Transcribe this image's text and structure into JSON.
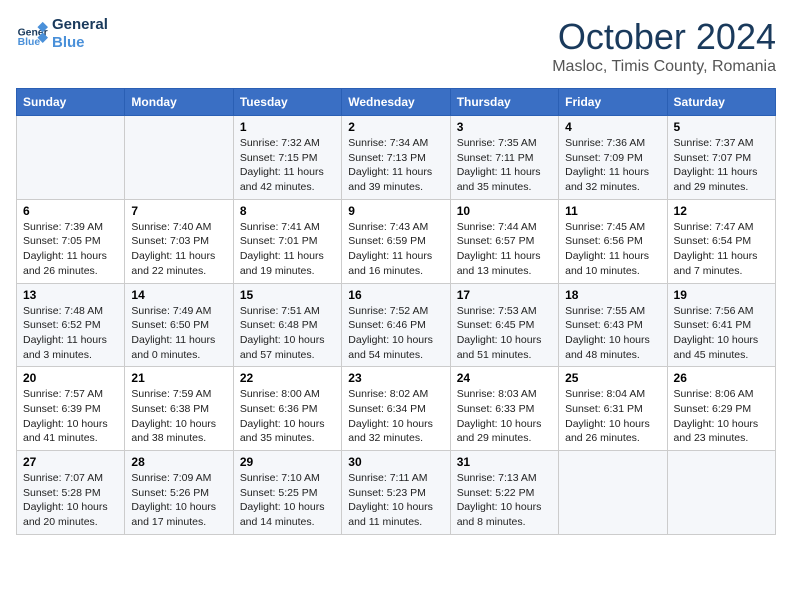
{
  "header": {
    "logo_line1": "General",
    "logo_line2": "Blue",
    "month": "October 2024",
    "location": "Masloc, Timis County, Romania"
  },
  "days_of_week": [
    "Sunday",
    "Monday",
    "Tuesday",
    "Wednesday",
    "Thursday",
    "Friday",
    "Saturday"
  ],
  "weeks": [
    [
      {
        "day": "",
        "info": ""
      },
      {
        "day": "",
        "info": ""
      },
      {
        "day": "1",
        "sunrise": "7:32 AM",
        "sunset": "7:15 PM",
        "daylight": "11 hours and 42 minutes."
      },
      {
        "day": "2",
        "sunrise": "7:34 AM",
        "sunset": "7:13 PM",
        "daylight": "11 hours and 39 minutes."
      },
      {
        "day": "3",
        "sunrise": "7:35 AM",
        "sunset": "7:11 PM",
        "daylight": "11 hours and 35 minutes."
      },
      {
        "day": "4",
        "sunrise": "7:36 AM",
        "sunset": "7:09 PM",
        "daylight": "11 hours and 32 minutes."
      },
      {
        "day": "5",
        "sunrise": "7:37 AM",
        "sunset": "7:07 PM",
        "daylight": "11 hours and 29 minutes."
      }
    ],
    [
      {
        "day": "6",
        "sunrise": "7:39 AM",
        "sunset": "7:05 PM",
        "daylight": "11 hours and 26 minutes."
      },
      {
        "day": "7",
        "sunrise": "7:40 AM",
        "sunset": "7:03 PM",
        "daylight": "11 hours and 22 minutes."
      },
      {
        "day": "8",
        "sunrise": "7:41 AM",
        "sunset": "7:01 PM",
        "daylight": "11 hours and 19 minutes."
      },
      {
        "day": "9",
        "sunrise": "7:43 AM",
        "sunset": "6:59 PM",
        "daylight": "11 hours and 16 minutes."
      },
      {
        "day": "10",
        "sunrise": "7:44 AM",
        "sunset": "6:57 PM",
        "daylight": "11 hours and 13 minutes."
      },
      {
        "day": "11",
        "sunrise": "7:45 AM",
        "sunset": "6:56 PM",
        "daylight": "11 hours and 10 minutes."
      },
      {
        "day": "12",
        "sunrise": "7:47 AM",
        "sunset": "6:54 PM",
        "daylight": "11 hours and 7 minutes."
      }
    ],
    [
      {
        "day": "13",
        "sunrise": "7:48 AM",
        "sunset": "6:52 PM",
        "daylight": "11 hours and 3 minutes."
      },
      {
        "day": "14",
        "sunrise": "7:49 AM",
        "sunset": "6:50 PM",
        "daylight": "11 hours and 0 minutes."
      },
      {
        "day": "15",
        "sunrise": "7:51 AM",
        "sunset": "6:48 PM",
        "daylight": "10 hours and 57 minutes."
      },
      {
        "day": "16",
        "sunrise": "7:52 AM",
        "sunset": "6:46 PM",
        "daylight": "10 hours and 54 minutes."
      },
      {
        "day": "17",
        "sunrise": "7:53 AM",
        "sunset": "6:45 PM",
        "daylight": "10 hours and 51 minutes."
      },
      {
        "day": "18",
        "sunrise": "7:55 AM",
        "sunset": "6:43 PM",
        "daylight": "10 hours and 48 minutes."
      },
      {
        "day": "19",
        "sunrise": "7:56 AM",
        "sunset": "6:41 PM",
        "daylight": "10 hours and 45 minutes."
      }
    ],
    [
      {
        "day": "20",
        "sunrise": "7:57 AM",
        "sunset": "6:39 PM",
        "daylight": "10 hours and 41 minutes."
      },
      {
        "day": "21",
        "sunrise": "7:59 AM",
        "sunset": "6:38 PM",
        "daylight": "10 hours and 38 minutes."
      },
      {
        "day": "22",
        "sunrise": "8:00 AM",
        "sunset": "6:36 PM",
        "daylight": "10 hours and 35 minutes."
      },
      {
        "day": "23",
        "sunrise": "8:02 AM",
        "sunset": "6:34 PM",
        "daylight": "10 hours and 32 minutes."
      },
      {
        "day": "24",
        "sunrise": "8:03 AM",
        "sunset": "6:33 PM",
        "daylight": "10 hours and 29 minutes."
      },
      {
        "day": "25",
        "sunrise": "8:04 AM",
        "sunset": "6:31 PM",
        "daylight": "10 hours and 26 minutes."
      },
      {
        "day": "26",
        "sunrise": "8:06 AM",
        "sunset": "6:29 PM",
        "daylight": "10 hours and 23 minutes."
      }
    ],
    [
      {
        "day": "27",
        "sunrise": "7:07 AM",
        "sunset": "5:28 PM",
        "daylight": "10 hours and 20 minutes."
      },
      {
        "day": "28",
        "sunrise": "7:09 AM",
        "sunset": "5:26 PM",
        "daylight": "10 hours and 17 minutes."
      },
      {
        "day": "29",
        "sunrise": "7:10 AM",
        "sunset": "5:25 PM",
        "daylight": "10 hours and 14 minutes."
      },
      {
        "day": "30",
        "sunrise": "7:11 AM",
        "sunset": "5:23 PM",
        "daylight": "10 hours and 11 minutes."
      },
      {
        "day": "31",
        "sunrise": "7:13 AM",
        "sunset": "5:22 PM",
        "daylight": "10 hours and 8 minutes."
      },
      {
        "day": "",
        "info": ""
      },
      {
        "day": "",
        "info": ""
      }
    ]
  ],
  "labels": {
    "sunrise": "Sunrise:",
    "sunset": "Sunset:",
    "daylight": "Daylight:"
  }
}
